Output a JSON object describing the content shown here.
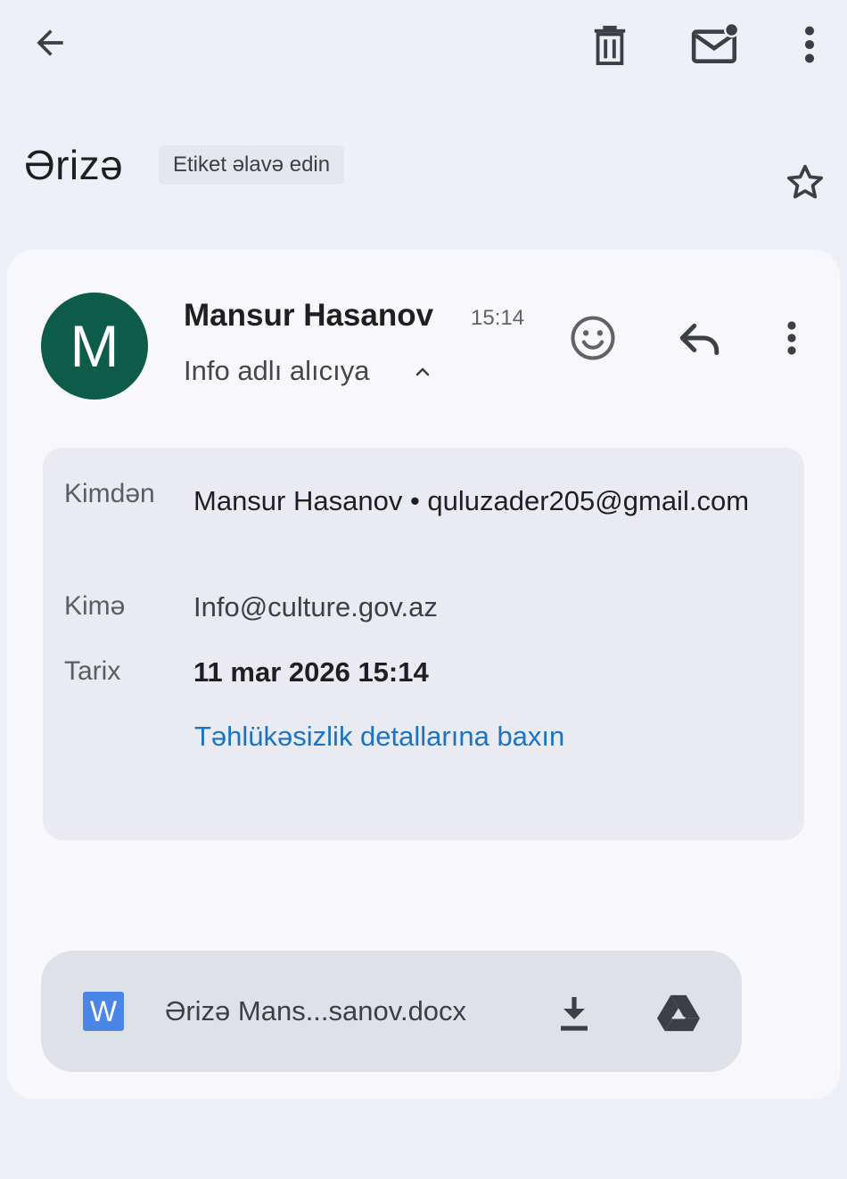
{
  "toolbar": {
    "back_icon": "arrow-back-icon",
    "delete_icon": "trash-icon",
    "mark_unread_icon": "mail-unread-icon",
    "more_icon": "more-vert-icon"
  },
  "subject": {
    "title": "Ərizə",
    "label_chip": "Etiket əlavə edin",
    "star_icon": "star-outline-icon"
  },
  "message": {
    "avatar_letter": "M",
    "avatar_color": "#0d5c4a",
    "sender_name": "Mansur Hasanov",
    "time": "15:14",
    "recipient_summary": "Info adlı alıcıya",
    "details": {
      "from_label": "Kimdən",
      "from_value": "Mansur Hasanov • quluzader205@gmail.com",
      "to_label": "Kimə",
      "to_value": "Info@culture.gov.az",
      "date_label": "Tarix",
      "date_value": "11 mar 2026 15:14",
      "security_link": "Təhlükəsizlik detallarına baxın"
    }
  },
  "attachment": {
    "file_icon_letter": "W",
    "file_icon_color": "#4a86e8",
    "filename": "Ərizə Mans...sanov.docx",
    "download_icon": "download-icon",
    "drive_icon": "google-drive-icon"
  },
  "colors": {
    "background": "#eef0f7",
    "card": "#f7f7fc",
    "details_box": "#e9eaf2",
    "link": "#1a73c4"
  }
}
